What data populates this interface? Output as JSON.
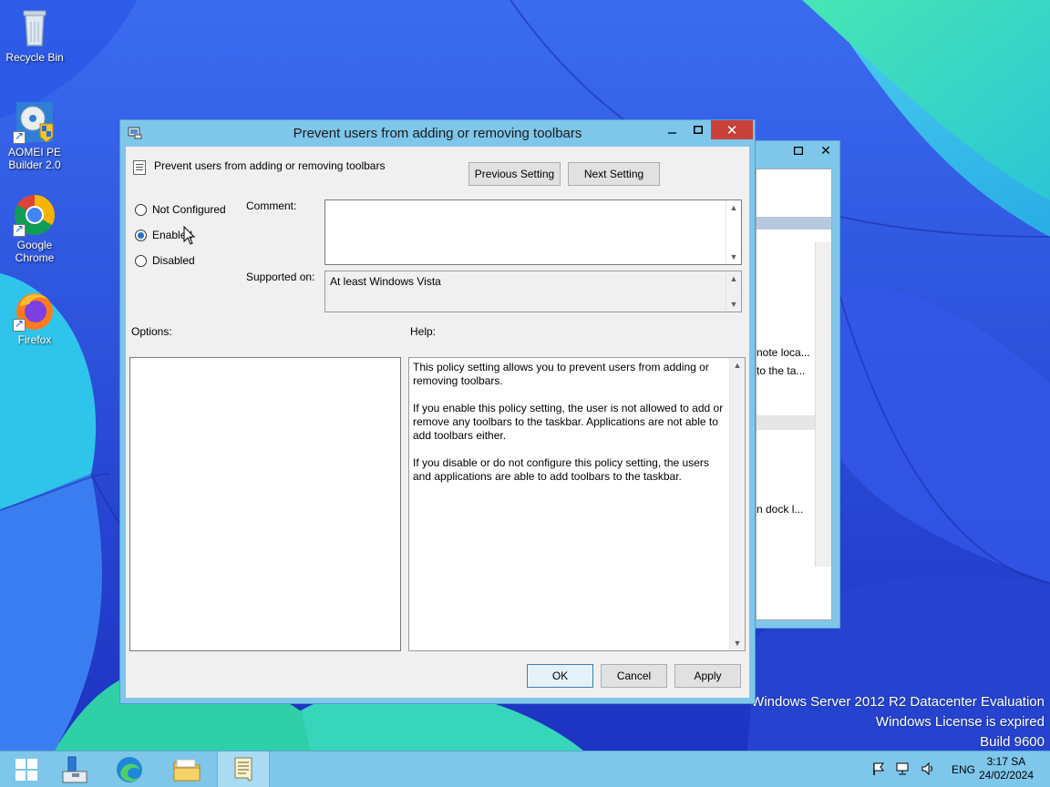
{
  "desktop": {
    "icons": [
      {
        "label_l1": "Recycle Bin",
        "label_l2": ""
      },
      {
        "label_l1": "AOMEI PE",
        "label_l2": "Builder 2.0"
      },
      {
        "label_l1": "Google",
        "label_l2": "Chrome"
      },
      {
        "label_l1": "Firefox",
        "label_l2": ""
      }
    ],
    "watermark": {
      "line1": "Windows Server 2012 R2 Datacenter Evaluation",
      "line2": "Windows License is expired",
      "line3": "Build 9600"
    }
  },
  "background_window": {
    "close_glyph": "✕",
    "text1": "note loca...",
    "text2": "to the ta...",
    "text3": "n dock l..."
  },
  "dialog": {
    "title": "Prevent users from adding or removing toolbars",
    "policy_name": "Prevent users from adding or removing toolbars",
    "previous_setting": "Previous Setting",
    "next_setting": "Next Setting",
    "radio_not_configured": "Not Configured",
    "radio_enabled": "Enabled",
    "radio_disabled": "Disabled",
    "selected_state": "Enabled",
    "comment_label": "Comment:",
    "comment_value": "",
    "supported_label": "Supported on:",
    "supported_value": "At least Windows Vista",
    "options_label": "Options:",
    "help_label": "Help:",
    "help_text": "This policy setting allows you to prevent users from adding or removing toolbars.\n\nIf you enable this policy setting, the user is not allowed to add or remove any toolbars to the taskbar. Applications are not able to add toolbars either.\n\nIf you disable or do not configure this policy setting, the users and applications are able to add toolbars to the taskbar.",
    "ok": "OK",
    "cancel": "Cancel",
    "apply": "Apply",
    "close_glyph": "✕"
  },
  "taskbar": {
    "language": "ENG",
    "time": "3:17 SA",
    "date": "24/02/2024"
  },
  "colors": {
    "titlebar": "#7ec6ea",
    "close_button": "#c7403a",
    "radio_selected": "#1a73c8",
    "wallpaper_blue": "#1f38c9",
    "wallpaper_cyan": "#3fd8e8"
  }
}
